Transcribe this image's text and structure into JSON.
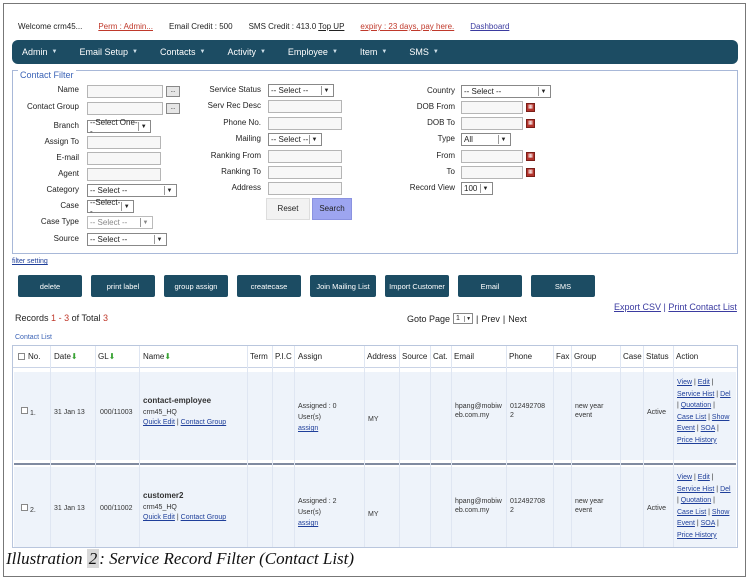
{
  "topbar": {
    "welcome": "Welcome crm45...",
    "perm": "Perm : Admin...",
    "email_credit": "Email Credit : 500",
    "sms_credit_prefix": "SMS Credit : 413.0",
    "topup": "Top UP",
    "expiry": "expiry : 23 days, pay here.",
    "dashboard": "Dashboard"
  },
  "nav": {
    "items": [
      "Admin",
      "Email Setup",
      "Contacts",
      "Activity",
      "Employee",
      "Item",
      "SMS"
    ]
  },
  "filter": {
    "legend": "Contact Filter",
    "col1": {
      "name_label": "Name",
      "contact_group_label": "Contact Group",
      "branch_label": "Branch",
      "branch_value": "--Select One--",
      "assign_to_label": "Assign To",
      "email_label": "E-mail",
      "agent_label": "Agent",
      "category_label": "Category",
      "category_value": "-- Select --",
      "case_label": "Case",
      "case_value": "--Select--",
      "case_type_label": "Case Type",
      "case_type_value": "-- Select --",
      "source_label": "Source",
      "source_value": "-- Select --"
    },
    "col2": {
      "service_status_label": "Service Status",
      "service_status_value": "-- Select --",
      "serv_rec_desc_label": "Serv Rec Desc",
      "phone_label": "Phone No.",
      "mailing_label": "Mailing",
      "mailing_value": "-- Select --",
      "ranking_from_label": "Ranking From",
      "ranking_to_label": "Ranking To",
      "address_label": "Address"
    },
    "col3": {
      "country_label": "Country",
      "country_value": "-- Select --",
      "dob_from_label": "DOB From",
      "dob_to_label": "DOB To",
      "type_label": "Type",
      "type_value": "All",
      "from_label": "From",
      "to_label": "To",
      "record_view_label": "Record View",
      "record_view_value": "100"
    },
    "reset_label": "Reset",
    "search_label": "Search",
    "filter_setting": "filter setting"
  },
  "actions": [
    "delete",
    "print label",
    "group assign",
    "createcase",
    "Join Mailing List",
    "Import Customer",
    "Email",
    "SMS"
  ],
  "records": {
    "prefix": "Records",
    "from": "1",
    "dash": "-",
    "to": "3",
    "of_total": "of Total",
    "total": "3",
    "goto_label": "Goto Page",
    "goto_value": "1",
    "sep1": "|",
    "prev": "Prev",
    "sep2": "|",
    "next": "Next"
  },
  "export": {
    "csv": "Export CSV",
    "sep": "|",
    "print": "Print Contact List"
  },
  "contact_list_label": "Contact List",
  "table": {
    "headers": {
      "no": "No.",
      "date": "Date",
      "gl": "GL",
      "name": "Name",
      "term": "Term",
      "pic": "P.I.C",
      "assign": "Assign",
      "address": "Address",
      "source": "Source",
      "cat": "Cat.",
      "email": "Email",
      "phone": "Phone",
      "fax": "Fax",
      "group": "Group",
      "case": "Case",
      "status": "Status",
      "action": "Action"
    },
    "rows": [
      {
        "no": "1.",
        "date": "31 Jan 13",
        "gl": "000/11003",
        "name": "contact-employee",
        "subname": "crm45_HQ",
        "quick_edit": "Quick Edit",
        "sep": "|",
        "contact_group": "Contact Group",
        "assigned": "Assigned : 0",
        "users": "User(s)",
        "assign_link": "assign",
        "address": "MY",
        "email1": "hpang@mobiw",
        "email2": "eb.com.my",
        "phone1": "012492708",
        "phone2": "2",
        "group1": "new year",
        "group2": "event",
        "status": "Active",
        "act": [
          "View",
          "|",
          "Edit",
          "|",
          "Service Hist",
          "|",
          "Del",
          "|",
          "Quotation",
          "|",
          "Case List",
          "|",
          "Show",
          "Event",
          "|",
          "SOA",
          "|",
          "Price History"
        ]
      },
      {
        "no": "2.",
        "date": "31 Jan 13",
        "gl": "000/11002",
        "name": "customer2",
        "subname": "crm45_HQ",
        "quick_edit": "Quick Edit",
        "sep": "|",
        "contact_group": "Contact Group",
        "assigned": "Assigned : 2",
        "users": "User(s)",
        "assign_link": "assign",
        "address": "MY",
        "email1": "hpang@mobiw",
        "email2": "eb.com.my",
        "phone1": "012492708",
        "phone2": "2",
        "group1": "new year",
        "group2": "event",
        "status": "Active",
        "act": [
          "View",
          "|",
          "Edit",
          "|",
          "Service Hist",
          "|",
          "Del",
          "|",
          "Quotation",
          "|",
          "Case List",
          "|",
          "Show",
          "Event",
          "|",
          "SOA",
          "|",
          "Price History"
        ]
      }
    ]
  },
  "caption": {
    "prefix": "Illustration",
    "number": "2",
    "text": ": Service Record Filter (Contact List)"
  }
}
